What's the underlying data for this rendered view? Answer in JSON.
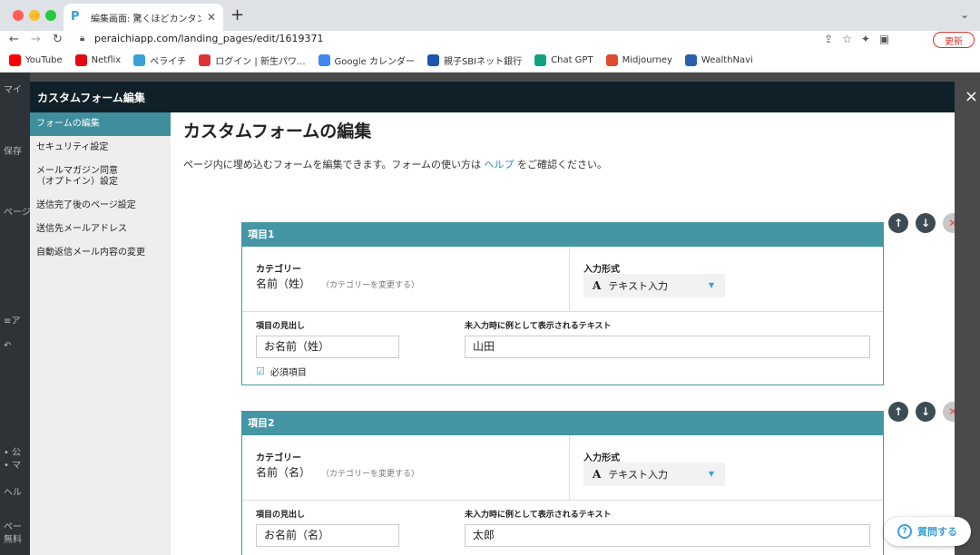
{
  "browser": {
    "tab_title": "編集画面: 驚くほどカンタン！無料",
    "url": "peraichiapp.com/landing_pages/edit/1619371",
    "update_label": "更新",
    "bookmarks": [
      {
        "label": "YouTube",
        "color": "#ff0000"
      },
      {
        "label": "Netflix",
        "color": "#e50914"
      },
      {
        "label": "ペライチ",
        "color": "#3aa0d8"
      },
      {
        "label": "ログイン | 新生パワ...",
        "color": "#d33"
      },
      {
        "label": "Google カレンダー",
        "color": "#4285f4"
      },
      {
        "label": "親子SBIネット銀行",
        "color": "#1a56b0"
      },
      {
        "label": "Chat GPT",
        "color": "#10a37f"
      },
      {
        "label": "Midjourney",
        "color": "#e04a2e"
      },
      {
        "label": "WealthNavi",
        "color": "#2a5fb0"
      }
    ]
  },
  "modal": {
    "title": "カスタムフォーム編集",
    "close": "×",
    "nav": [
      "フォームの編集",
      "セキュリティ設定",
      "メールマガジン同意（オプトイン）設定",
      "送信完了後のページ設定",
      "送信先メールアドレス",
      "自動返信メール内容の変更"
    ],
    "heading": "カスタムフォームの編集",
    "desc_before": "ページ内に埋め込むフォームを編集できます。フォームの使い方は ",
    "desc_link": "ヘルプ",
    "desc_after": " をご確認ください。"
  },
  "labels": {
    "category": "カテゴリー",
    "change_category": "（カテゴリーを変更する）",
    "input_type": "入力形式",
    "item_heading": "項目の見出し",
    "placeholder_text": "未入力時に例として表示されるテキスト",
    "required": "必須項目"
  },
  "items": [
    {
      "title": "項目1",
      "category": "名前（姓）",
      "input_type": "テキスト入力",
      "heading": "お名前（姓）",
      "placeholder": "山田"
    },
    {
      "title": "項目2",
      "category": "名前（名）",
      "input_type": "テキスト入力",
      "heading": "お名前（名）",
      "placeholder": "太郎"
    }
  ],
  "ask_button": "質問する"
}
